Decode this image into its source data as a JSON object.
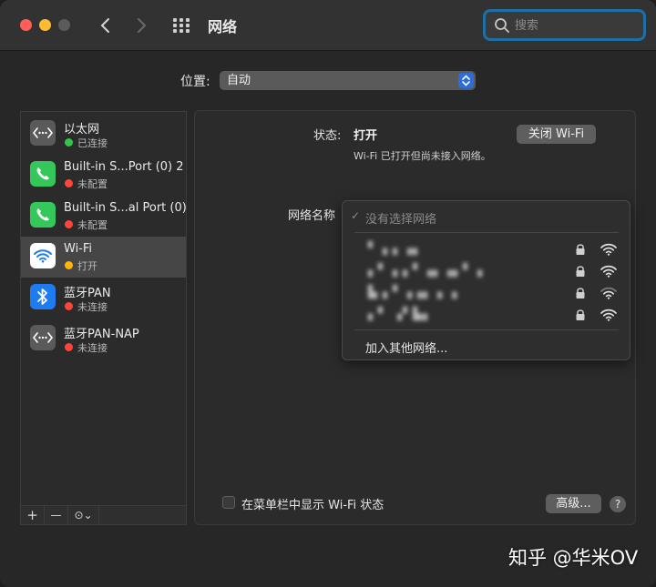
{
  "window": {
    "title": "网络"
  },
  "search": {
    "placeholder": "搜索",
    "value": ""
  },
  "location": {
    "label": "位置:",
    "value": "自动"
  },
  "sidebar": {
    "items": [
      {
        "name": "以太网",
        "status": "已连接",
        "status_color": "#30c748",
        "icon": "ethernet-icon",
        "icon_bg": "#5a5a5a"
      },
      {
        "name": "Built-in S...Port (0) 2",
        "status": "未配置",
        "status_color": "#ff453a",
        "icon": "phone-icon",
        "icon_bg": "#34c759"
      },
      {
        "name": "Built-in S...al Port (0)",
        "status": "未配置",
        "status_color": "#ff453a",
        "icon": "phone-icon",
        "icon_bg": "#34c759"
      },
      {
        "name": "Wi-Fi",
        "status": "打开",
        "status_color": "#ffb600",
        "icon": "wifi-icon",
        "icon_bg": "#ffffff"
      },
      {
        "name": "蓝牙PAN",
        "status": "未连接",
        "status_color": "#ff453a",
        "icon": "bluetooth-icon",
        "icon_bg": "#1f7cf0"
      },
      {
        "name": "蓝牙PAN-NAP",
        "status": "未连接",
        "status_color": "#ff453a",
        "icon": "ethernet-icon",
        "icon_bg": "#5a5a5a"
      }
    ],
    "toolbar": {
      "add": "+",
      "remove": "—",
      "action": "⊙⌄"
    }
  },
  "detail": {
    "status_label": "状态:",
    "status_value": "打开",
    "status_description": "Wi-Fi 已打开但尚未接入网络。",
    "wifi_off_button": "关闭 Wi-Fi",
    "network_name_label": "网络名称",
    "show_in_menubar_label": "在菜单栏中显示 Wi-Fi 状态",
    "advanced_button": "高级...",
    "help_button": "?"
  },
  "network_menu": {
    "none_selected": "没有选择网络",
    "checkmark": "✓",
    "networks": [
      {
        "name": "▘▗ ▖▗▖",
        "locked": true
      },
      {
        "name": "▖▘▗ ▖▘▗▖▗▖▘▗",
        "locked": true
      },
      {
        "name": "▙▗ ▘▗▗▖▗ ▗",
        "locked": true
      },
      {
        "name": "▖▘ ▗▘▙▖",
        "locked": true
      }
    ],
    "join_other": "加入其他网络..."
  },
  "watermark": "知乎 @华米OV",
  "colors": {
    "accent": "#1d6fa8",
    "stepper": "#2c6ed5"
  }
}
